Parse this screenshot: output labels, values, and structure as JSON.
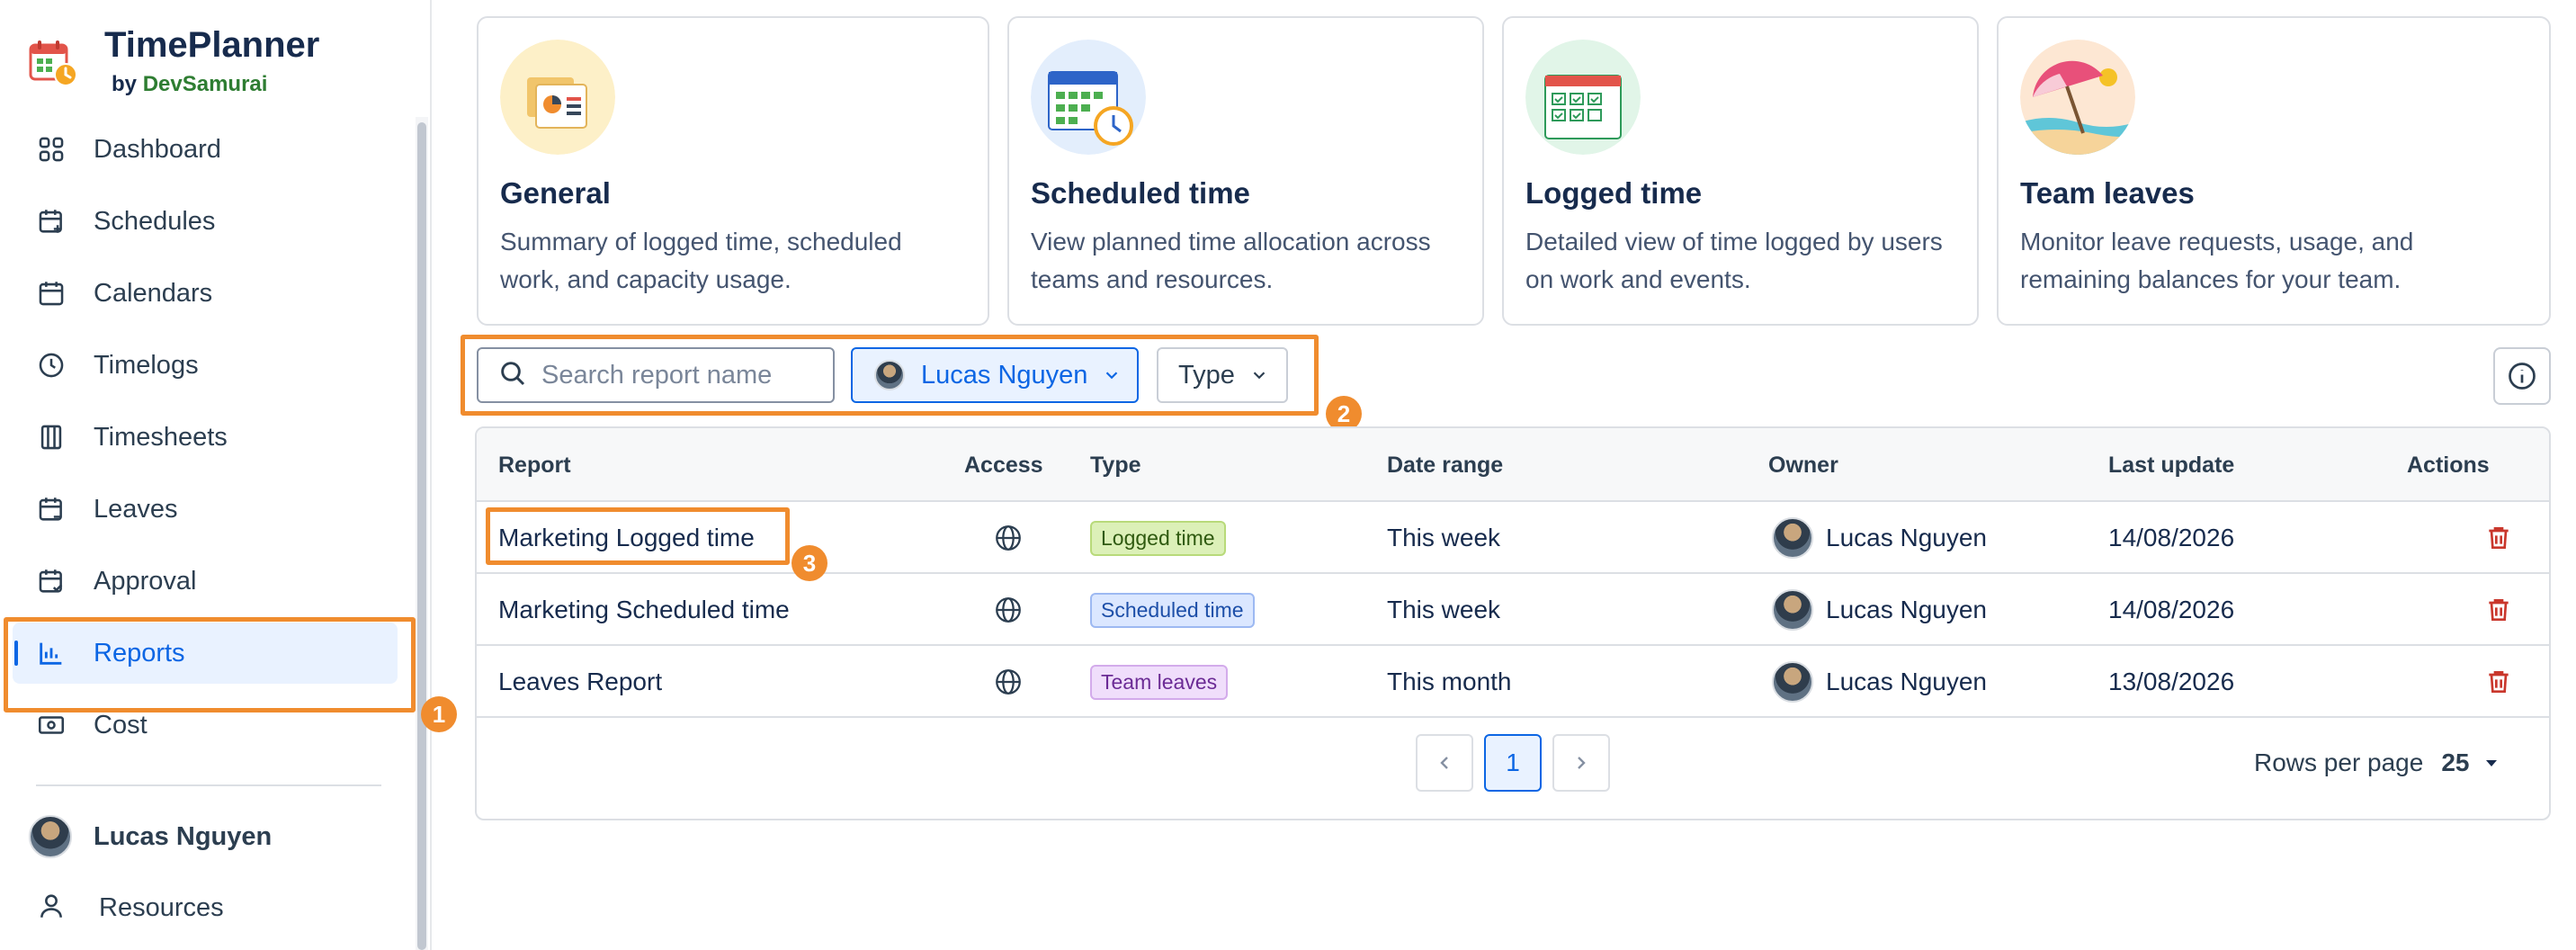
{
  "app": {
    "title": "TimePlanner",
    "by_prefix": "by",
    "by_org": "DevSamurai"
  },
  "sidebar": {
    "items": [
      {
        "label": "Dashboard",
        "icon": "dashboard-icon"
      },
      {
        "label": "Schedules",
        "icon": "calendar-plus-icon"
      },
      {
        "label": "Calendars",
        "icon": "calendar-icon"
      },
      {
        "label": "Timelogs",
        "icon": "clock-icon"
      },
      {
        "label": "Timesheets",
        "icon": "timesheet-icon"
      },
      {
        "label": "Leaves",
        "icon": "calendar-minus-icon"
      },
      {
        "label": "Approval",
        "icon": "calendar-check-icon"
      },
      {
        "label": "Reports",
        "icon": "bar-chart-icon",
        "active": true
      },
      {
        "label": "Cost",
        "icon": "money-icon"
      }
    ],
    "user": "Lucas Nguyen",
    "resources": "Resources"
  },
  "cards": [
    {
      "title": "General",
      "desc": "Summary of logged time, scheduled work, and capacity usage.",
      "icon": "general-report-illustration"
    },
    {
      "title": "Scheduled time",
      "desc": "View planned time allocation across teams and resources.",
      "icon": "scheduled-calendar-illustration"
    },
    {
      "title": "Logged time",
      "desc": "Detailed view of time logged by users on work and events.",
      "icon": "logged-time-illustration"
    },
    {
      "title": "Team leaves",
      "desc": "Monitor leave requests, usage, and remaining balances for your team.",
      "icon": "beach-umbrella-illustration"
    }
  ],
  "filters": {
    "search_placeholder": "Search report name",
    "search_value": "",
    "owner": "Lucas Nguyen",
    "type": "Type"
  },
  "table": {
    "columns": [
      "Report",
      "Access",
      "Type",
      "Date range",
      "Owner",
      "Last update",
      "Actions"
    ],
    "rows": [
      {
        "report": "Marketing Logged time",
        "type": "Logged time",
        "date_range": "This week",
        "owner": "Lucas Nguyen",
        "last_update": "14/08/2026"
      },
      {
        "report": "Marketing Scheduled time",
        "type": "Scheduled time",
        "date_range": "This week",
        "owner": "Lucas Nguyen",
        "last_update": "14/08/2026"
      },
      {
        "report": "Leaves Report",
        "type": "Team leaves",
        "date_range": "This month",
        "owner": "Lucas Nguyen",
        "last_update": "13/08/2026"
      }
    ],
    "pagination": {
      "current_page": "1",
      "rows_per_page_label": "Rows per page",
      "rows_per_page": "25"
    }
  },
  "annotations": [
    "1",
    "2",
    "3"
  ],
  "colors": {
    "accent": "#0c66e4",
    "highlight": "#f08c2e",
    "danger": "#c9372c",
    "brand_green": "#2e7d32"
  }
}
